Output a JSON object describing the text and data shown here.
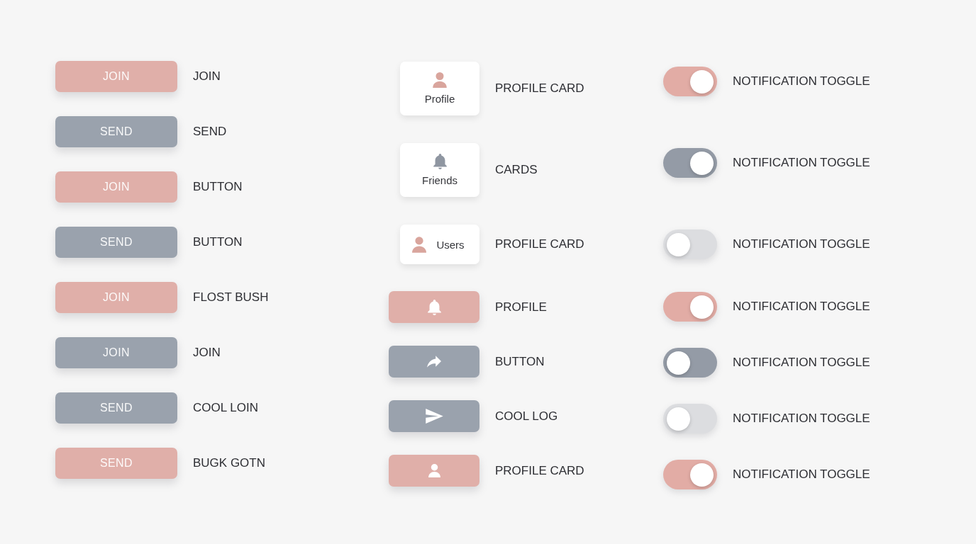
{
  "buttons": [
    {
      "text": "JOIN",
      "color": "#e0afa9",
      "label": "JOIN"
    },
    {
      "text": "SEND",
      "color": "#9aa2ad",
      "label": "SEND"
    },
    {
      "text": "JOIN",
      "color": "#e0afa9",
      "label": "BUTTON"
    },
    {
      "text": "SEND",
      "color": "#9aa2ad",
      "label": "BUTTON"
    },
    {
      "text": "JOIN",
      "color": "#e0afa9",
      "label": "FLOST BUSH"
    },
    {
      "text": "JOIN",
      "color": "#9aa2ad",
      "label": "JOIN"
    },
    {
      "text": "SEND",
      "color": "#9aa2ad",
      "label": "COOL LOIN"
    },
    {
      "text": "SEND",
      "color": "#e0afa9",
      "label": "BUGK GOTN"
    }
  ],
  "cards": [
    {
      "kind": "stacked",
      "text": "Profile",
      "label": "PROFILE CARD"
    },
    {
      "kind": "stacked",
      "text": "Friends",
      "label": "CARDS"
    },
    {
      "kind": "inline",
      "text": "Users",
      "label": "PROFILE CARD"
    }
  ],
  "icon_buttons": [
    {
      "color": "#e0afa9",
      "label": "PROFILE"
    },
    {
      "color": "#9aa2ad",
      "label": "BUTTON"
    },
    {
      "color": "#9aa2ad",
      "label": "COOL LOG"
    },
    {
      "color": "#e0afa9",
      "label": "PROFILE CARD"
    }
  ],
  "toggles": [
    {
      "on": true,
      "color": "#e2aca5",
      "label": "NOTIFICATION TOGGLE"
    },
    {
      "on": true,
      "color": "#949ba6",
      "label": "NOTIFICATION TOGGLE"
    },
    {
      "on": false,
      "color": "#dcdde0",
      "label": "NOTIFICATION TOGGLE"
    },
    {
      "on": true,
      "color": "#e2aca5",
      "label": "NOTIFICATION TOGGLE"
    },
    {
      "on": false,
      "color": "#949ba6",
      "label": "NOTIFICATION TOGGLE"
    },
    {
      "on": false,
      "color": "#dcdde0",
      "label": "NOTIFICATION TOGGLE"
    },
    {
      "on": true,
      "color": "#e2aca5",
      "label": "NOTIFICATION TOGGLE"
    }
  ]
}
